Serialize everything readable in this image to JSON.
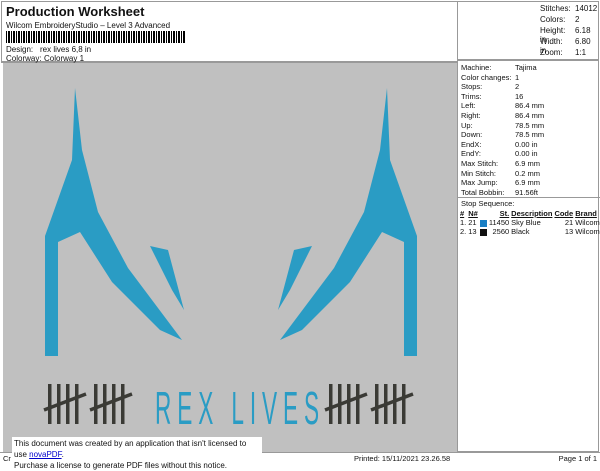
{
  "header": {
    "title": "Production Worksheet",
    "subtitle": "Wilcom EmbroideryStudio – Level 3 Advanced",
    "design_label": "Design:",
    "design_value": "rex lives 6,8 in",
    "colorway_label": "Colorway:",
    "colorway_value": "Colorway 1"
  },
  "stats": [
    {
      "label": "Stitches:",
      "value": "14012"
    },
    {
      "label": "Colors:",
      "value": "2"
    },
    {
      "label": "Height:",
      "value": "6.18 in"
    },
    {
      "label": "Width:",
      "value": "6.80 in"
    },
    {
      "label": "Zoom:",
      "value": "1:1"
    }
  ],
  "info": [
    {
      "label": "Machine:",
      "value": "Tajima"
    },
    {
      "label": "Color changes:",
      "value": "1"
    },
    {
      "label": "Stops:",
      "value": "2"
    },
    {
      "label": "Trims:",
      "value": "16"
    },
    {
      "label": "Left:",
      "value": "86.4 mm"
    },
    {
      "label": "Right:",
      "value": "86.4 mm"
    },
    {
      "label": "Up:",
      "value": "78.5 mm"
    },
    {
      "label": "Down:",
      "value": "78.5 mm"
    },
    {
      "label": "EndX:",
      "value": "0.00 in"
    },
    {
      "label": "EndY:",
      "value": "0.00 in"
    },
    {
      "label": "Max Stitch:",
      "value": "6.9 mm"
    },
    {
      "label": "Min Stitch:",
      "value": "0.2 mm"
    },
    {
      "label": "Max Jump:",
      "value": "6.9 mm"
    },
    {
      "label": "Total Bobbin:",
      "value": "91.56ft"
    }
  ],
  "stop_sequence": {
    "title": "Stop Sequence:",
    "headers": [
      "#",
      "N#",
      "St.",
      "Description",
      "Code",
      "Brand"
    ],
    "rows": [
      {
        "n": "1.",
        "needle": "21",
        "color": "#1a7fc4",
        "stitches": "11450",
        "desc": "Sky Blue",
        "code": "21",
        "brand": "Wilcom"
      },
      {
        "n": "2.",
        "needle": "13",
        "color": "#111111",
        "stitches": "2560",
        "desc": "Black",
        "code": "13",
        "brand": "Wilcom"
      }
    ]
  },
  "design": {
    "text": "REX LIVES",
    "thread_blue": "#2a9cc4",
    "thread_dark": "#3a3a35",
    "background": "#c0c0c0"
  },
  "footer": {
    "left": "Cr",
    "printed": "Printed: 15/11/2021 23.26.58",
    "page": "Page 1 of 1"
  },
  "notice": {
    "line1": "This document was created by an application that isn't licensed to use ",
    "link": "novaPDF",
    "line1_end": ".",
    "line2": "Purchase a license to generate PDF files without this notice."
  }
}
